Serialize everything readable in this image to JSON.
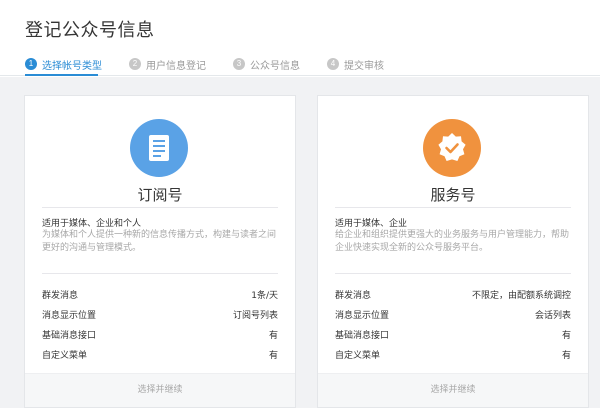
{
  "page": {
    "title": "登记公众号信息"
  },
  "steps": [
    {
      "num": "1",
      "label": "选择帐号类型"
    },
    {
      "num": "2",
      "label": "用户信息登记"
    },
    {
      "num": "3",
      "label": "公众号信息"
    },
    {
      "num": "4",
      "label": "提交审核"
    }
  ],
  "colors": {
    "accent": "#2a8cd5",
    "subscription_icon_bg": "#5aa2e6",
    "service_icon_bg": "#f0923e"
  },
  "cards": [
    {
      "icon": "document-icon",
      "title": "订阅号",
      "subtitle": "适用于媒体、企业和个人",
      "description": "为媒体和个人提供一种新的信息传播方式，构建与读者之间更好的沟通与管理模式。",
      "specs": [
        {
          "key": "群发消息",
          "value": "1条/天"
        },
        {
          "key": "消息显示位置",
          "value": "订阅号列表"
        },
        {
          "key": "基础消息接口",
          "value": "有"
        },
        {
          "key": "自定义菜单",
          "value": "有"
        }
      ],
      "action": "选择并继续"
    },
    {
      "icon": "verified-badge-icon",
      "title": "服务号",
      "subtitle": "适用于媒体、企业",
      "description": "给企业和组织提供更强大的业务服务与用户管理能力，帮助企业快速实现全新的公众号服务平台。",
      "specs": [
        {
          "key": "群发消息",
          "value": "不限定，由配额系统调控"
        },
        {
          "key": "消息显示位置",
          "value": "会话列表"
        },
        {
          "key": "基础消息接口",
          "value": "有"
        },
        {
          "key": "自定义菜单",
          "value": "有"
        }
      ],
      "action": "选择并继续"
    }
  ]
}
